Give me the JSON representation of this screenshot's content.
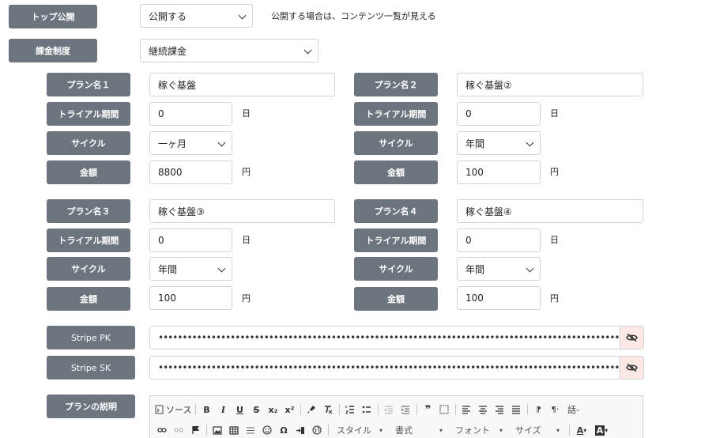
{
  "top_public": {
    "label": "トップ公開",
    "value": "公開する",
    "note": "公開する場合は、コンテンツ一覧が見える"
  },
  "billing": {
    "label": "課金制度",
    "value": "継続課金"
  },
  "field_labels": {
    "name": "プラン名",
    "trial": "トライアル期間",
    "cycle": "サイクル",
    "price": "金額"
  },
  "units": {
    "day": "日",
    "yen": "円"
  },
  "plans": [
    {
      "name_label": "プラン名１",
      "name": "稼ぐ基盤",
      "trial": "0",
      "cycle": "一ヶ月",
      "price": "8800"
    },
    {
      "name_label": "プラン名２",
      "name": "稼ぐ基盤②",
      "trial": "0",
      "cycle": "年間",
      "price": "100"
    },
    {
      "name_label": "プラン名３",
      "name": "稼ぐ基盤③",
      "trial": "0",
      "cycle": "年間",
      "price": "100"
    },
    {
      "name_label": "プラン名４",
      "name": "稼ぐ基盤④",
      "trial": "0",
      "cycle": "年間",
      "price": "100"
    }
  ],
  "stripe": {
    "pk_label": "Stripe PK",
    "sk_label": "Stripe SK",
    "pk_mask": "••••••••••••••••••••••••••••••••••••••••••••••••••••••••••••••••••••••••••••••••••••••••••••••••••••••••••••••••••",
    "sk_mask": "••••••••••••••••••••••••••••••••••••••••••••••••••••••••••••••••••••••••••••••••••••••••••••••••••••••••••••••••••"
  },
  "description": {
    "label": "プランの説明",
    "toolbar": {
      "source": "ソース",
      "bold": "B",
      "italic": "I",
      "underline": "U",
      "strike": "S",
      "sub": "x₂",
      "sup": "x²",
      "quote": "❞",
      "style": "スタイル",
      "format": "書式",
      "font": "フォント",
      "size": "サイズ",
      "lang": "話-",
      "font_color": "A",
      "bg_color": "A"
    }
  }
}
